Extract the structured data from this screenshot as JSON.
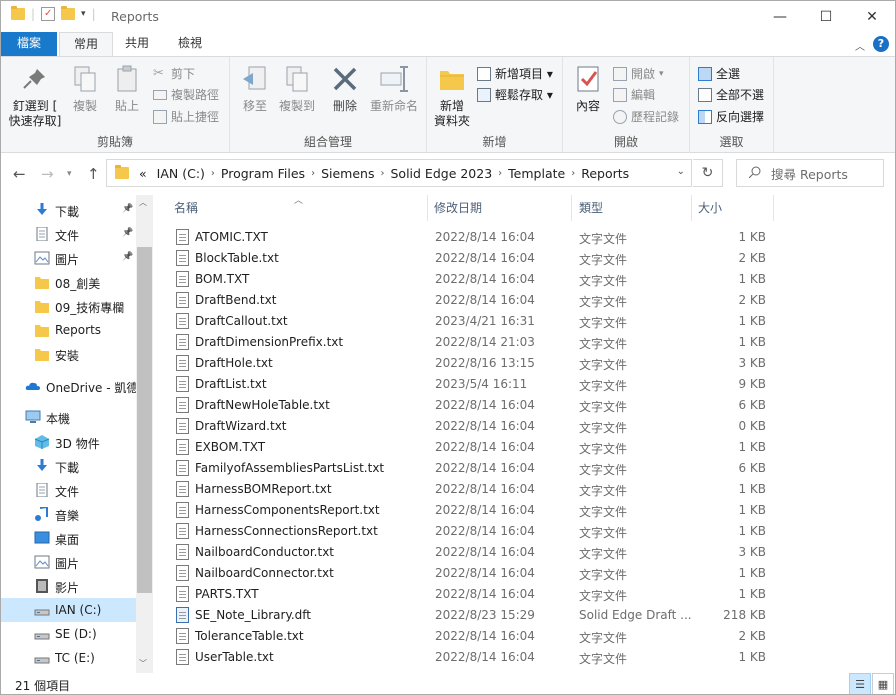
{
  "title": "Reports",
  "window_controls": {
    "minimize": "—",
    "maximize": "☐",
    "close": "✕"
  },
  "tabs": [
    "檔案",
    "常用",
    "共用",
    "檢視"
  ],
  "ribbon": {
    "clipboard": {
      "label": "剪貼簿",
      "pin_line1": "釘選到 [",
      "pin_line2": "快速存取]",
      "copy": "複製",
      "paste": "貼上",
      "cut": "剪下",
      "copy_path": "複製路徑",
      "paste_shortcut": "貼上捷徑"
    },
    "organize": {
      "label": "組合管理",
      "move_to": "移至",
      "copy_to": "複製到",
      "delete": "刪除",
      "rename": "重新命名"
    },
    "new": {
      "label": "新增",
      "new_folder_line1": "新增",
      "new_folder_line2": "資料夾",
      "new_item": "新增項目 ▾",
      "easy_access": "輕鬆存取 ▾"
    },
    "open": {
      "label": "開啟",
      "properties": "內容",
      "open": "開啟",
      "edit": "編輯",
      "history": "歷程記錄"
    },
    "select": {
      "label": "選取",
      "select_all": "全選",
      "select_none": "全部不選",
      "invert": "反向選擇"
    }
  },
  "address": {
    "segments": [
      "IAN (C:)",
      "Program Files",
      "Siemens",
      "Solid Edge 2023",
      "Template",
      "Reports"
    ],
    "overflow": "«"
  },
  "search": {
    "placeholder": "搜尋 Reports"
  },
  "nav": {
    "items": [
      {
        "label": "下載",
        "pinned": true,
        "icon": "download-icon"
      },
      {
        "label": "文件",
        "pinned": true,
        "icon": "document-icon"
      },
      {
        "label": "圖片",
        "pinned": true,
        "icon": "picture-icon"
      },
      {
        "label": "08_創美",
        "pinned": false,
        "icon": "folder-icon"
      },
      {
        "label": "09_技術專欄",
        "pinned": false,
        "icon": "folder-icon"
      },
      {
        "label": "Reports",
        "pinned": false,
        "icon": "folder-icon"
      },
      {
        "label": "安裝",
        "pinned": false,
        "icon": "folder-icon"
      },
      {
        "label": "OneDrive - 凱德",
        "pinned": false,
        "icon": "cloud-icon"
      },
      {
        "label": "本機",
        "pinned": false,
        "icon": "computer-icon"
      },
      {
        "label": "3D 物件",
        "pinned": false,
        "icon": "3d-objects-icon"
      },
      {
        "label": "下載",
        "pinned": false,
        "icon": "download-icon"
      },
      {
        "label": "文件",
        "pinned": false,
        "icon": "document-icon"
      },
      {
        "label": "音樂",
        "pinned": false,
        "icon": "music-icon"
      },
      {
        "label": "桌面",
        "pinned": false,
        "icon": "desktop-icon"
      },
      {
        "label": "圖片",
        "pinned": false,
        "icon": "picture-icon"
      },
      {
        "label": "影片",
        "pinned": false,
        "icon": "video-icon"
      },
      {
        "label": "IAN (C:)",
        "pinned": false,
        "icon": "drive-icon",
        "selected": true
      },
      {
        "label": "SE (D:)",
        "pinned": false,
        "icon": "drive-icon"
      },
      {
        "label": "TC (E:)",
        "pinned": false,
        "icon": "drive-icon"
      }
    ]
  },
  "columns": {
    "name": "名稱",
    "date": "修改日期",
    "type": "類型",
    "size": "大小"
  },
  "files": [
    {
      "name": "ATOMIC.TXT",
      "date": "2022/8/14 16:04",
      "type": "文字文件",
      "size": "1 KB"
    },
    {
      "name": "BlockTable.txt",
      "date": "2022/8/14 16:04",
      "type": "文字文件",
      "size": "2 KB"
    },
    {
      "name": "BOM.TXT",
      "date": "2022/8/14 16:04",
      "type": "文字文件",
      "size": "1 KB"
    },
    {
      "name": "DraftBend.txt",
      "date": "2022/8/14 16:04",
      "type": "文字文件",
      "size": "2 KB"
    },
    {
      "name": "DraftCallout.txt",
      "date": "2023/4/21 16:31",
      "type": "文字文件",
      "size": "1 KB"
    },
    {
      "name": "DraftDimensionPrefix.txt",
      "date": "2022/8/14 21:03",
      "type": "文字文件",
      "size": "1 KB"
    },
    {
      "name": "DraftHole.txt",
      "date": "2022/8/16 13:15",
      "type": "文字文件",
      "size": "3 KB"
    },
    {
      "name": "DraftList.txt",
      "date": "2023/5/4 16:11",
      "type": "文字文件",
      "size": "9 KB"
    },
    {
      "name": "DraftNewHoleTable.txt",
      "date": "2022/8/14 16:04",
      "type": "文字文件",
      "size": "6 KB"
    },
    {
      "name": "DraftWizard.txt",
      "date": "2022/8/14 16:04",
      "type": "文字文件",
      "size": "0 KB"
    },
    {
      "name": "EXBOM.TXT",
      "date": "2022/8/14 16:04",
      "type": "文字文件",
      "size": "1 KB"
    },
    {
      "name": "FamilyofAssembliesPartsList.txt",
      "date": "2022/8/14 16:04",
      "type": "文字文件",
      "size": "6 KB"
    },
    {
      "name": "HarnessBOMReport.txt",
      "date": "2022/8/14 16:04",
      "type": "文字文件",
      "size": "1 KB"
    },
    {
      "name": "HarnessComponentsReport.txt",
      "date": "2022/8/14 16:04",
      "type": "文字文件",
      "size": "1 KB"
    },
    {
      "name": "HarnessConnectionsReport.txt",
      "date": "2022/8/14 16:04",
      "type": "文字文件",
      "size": "1 KB"
    },
    {
      "name": "NailboardConductor.txt",
      "date": "2022/8/14 16:04",
      "type": "文字文件",
      "size": "3 KB"
    },
    {
      "name": "NailboardConnector.txt",
      "date": "2022/8/14 16:04",
      "type": "文字文件",
      "size": "1 KB"
    },
    {
      "name": "PARTS.TXT",
      "date": "2022/8/14 16:04",
      "type": "文字文件",
      "size": "1 KB"
    },
    {
      "name": "SE_Note_Library.dft",
      "date": "2022/8/23 15:29",
      "type": "Solid Edge Draft ...",
      "size": "218 KB"
    },
    {
      "name": "ToleranceTable.txt",
      "date": "2022/8/14 16:04",
      "type": "文字文件",
      "size": "2 KB"
    },
    {
      "name": "UserTable.txt",
      "date": "2022/8/14 16:04",
      "type": "文字文件",
      "size": "1 KB"
    }
  ],
  "status": {
    "count": "21 個項目"
  },
  "colors": {
    "accent": "#1979ca",
    "selection": "#cce8ff",
    "folder": "#f5c84c"
  }
}
